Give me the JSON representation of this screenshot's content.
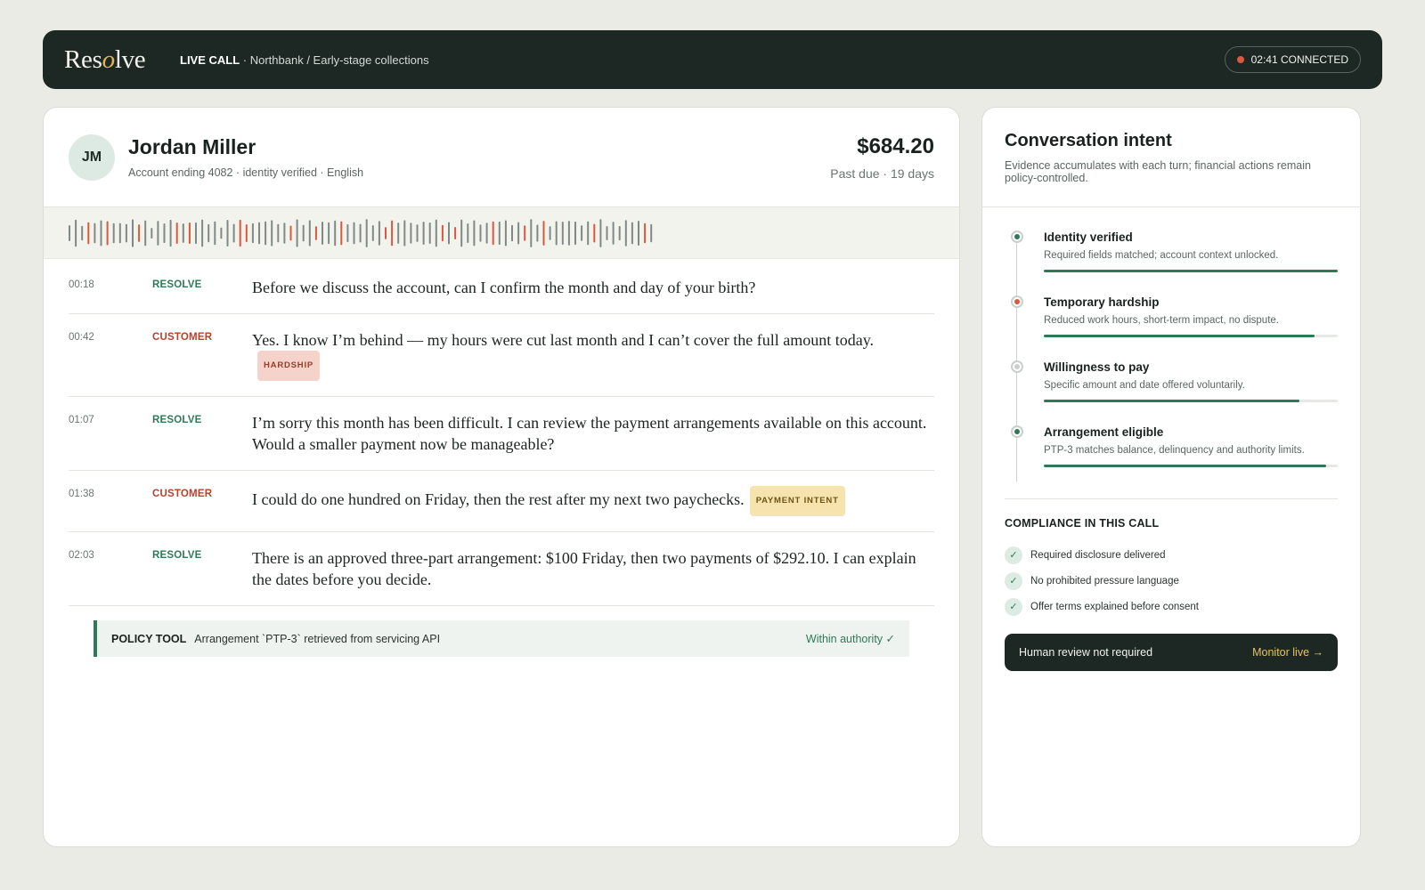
{
  "app": {
    "logo": {
      "pre": "Res",
      "accent": "o",
      "post": "lve"
    },
    "live_label": "LIVE CALL",
    "context": "· Northbank / Early-stage collections",
    "status": "02:41 CONNECTED"
  },
  "customer": {
    "initials": "JM",
    "name": "Jordan Miller",
    "details": "Account ending 4082 · identity verified · English",
    "amount": "$684.20",
    "due": "Past due · 19 days"
  },
  "transcript": [
    {
      "time": "00:18",
      "speaker": "RESOLVE",
      "text": "Before we discuss the account, can I confirm the month and day of your birth?"
    },
    {
      "time": "00:42",
      "speaker": "CUSTOMER",
      "text": "Yes. I know I’m behind — my hours were cut last month and I can’t cover the full amount today.",
      "tag": "HARDSHIP"
    },
    {
      "time": "01:07",
      "speaker": "RESOLVE",
      "text": "I’m sorry this month has been difficult. I can review the payment arrangements available on this account. Would a smaller payment now be manageable?"
    },
    {
      "time": "01:38",
      "speaker": "CUSTOMER",
      "text": "I could do one hundred on Friday, then the rest after my next two paychecks.",
      "tag": "PAYMENT INTENT"
    },
    {
      "time": "02:03",
      "speaker": "RESOLVE",
      "text": "There is an approved three-part arrangement: $100 Friday, then two payments of $292.10. I can explain the dates before you decide."
    }
  ],
  "policy": {
    "label": "POLICY TOOL",
    "text": "Arrangement `PTP-3` retrieved from servicing API",
    "status": "Within authority ✓"
  },
  "intent_panel": {
    "title": "Conversation intent",
    "description": "Evidence accumulates with each turn; financial actions remain policy-controlled.",
    "intents": [
      {
        "name": "Identity verified",
        "desc": "Required fields matched; account context unlocked.",
        "level": 1.0,
        "color": "#2e7a57"
      },
      {
        "name": "Temporary hardship",
        "desc": "Reduced work hours, short-term impact, no dispute.",
        "level": 0.92,
        "color": "#d9583e"
      },
      {
        "name": "Willingness to pay",
        "desc": "Specific amount and date offered voluntarily.",
        "level": 0.87,
        "color": "#c9cfcc"
      },
      {
        "name": "Arrangement eligible",
        "desc": "PTP-3 matches balance, delinquency and authority limits.",
        "level": 0.96,
        "color": "#2e7a57"
      }
    ]
  },
  "compliance": {
    "title": "COMPLIANCE IN THIS CALL",
    "items": [
      "Required disclosure delivered",
      "No prohibited pressure language",
      "Offer terms explained before consent"
    ]
  },
  "review": {
    "text": "Human review not required",
    "action": "Monitor live →"
  },
  "colors": {
    "accent_green": "#2e7a57",
    "accent_red": "#b3432c",
    "dark_bg": "#1d2824",
    "gold": "#e8c063"
  },
  "icons": [
    "status-dot-icon",
    "intent-dot-icon",
    "check-icon",
    "arrow-right-icon"
  ]
}
